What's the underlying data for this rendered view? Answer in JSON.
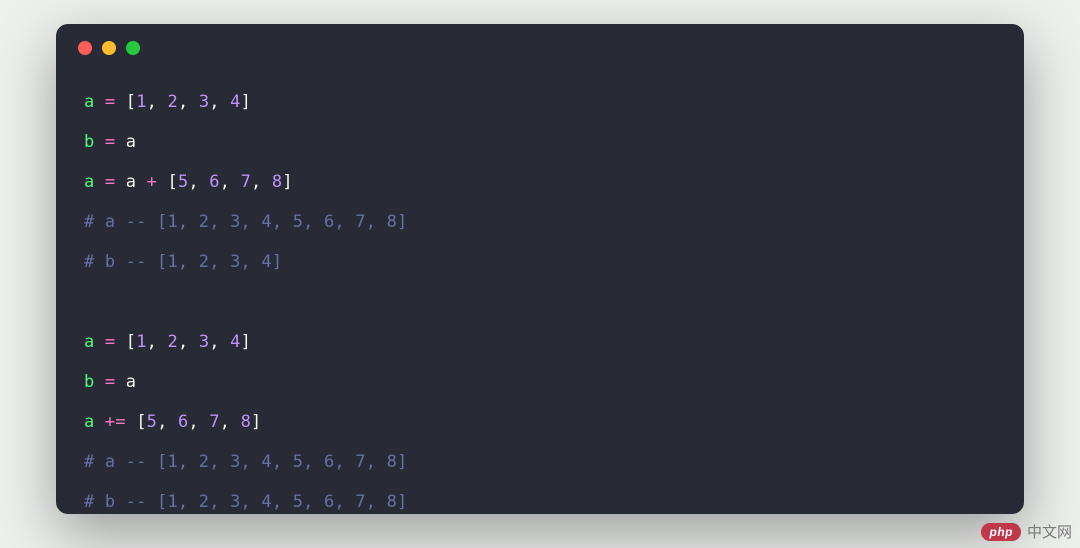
{
  "traffic_lights": [
    "red",
    "yellow",
    "green"
  ],
  "code": {
    "lines": [
      [
        {
          "cls": "tok-var",
          "t": "a"
        },
        {
          "cls": "tok-plain",
          "t": " "
        },
        {
          "cls": "tok-op",
          "t": "="
        },
        {
          "cls": "tok-plain",
          "t": " "
        },
        {
          "cls": "tok-bracket",
          "t": "["
        },
        {
          "cls": "tok-num",
          "t": "1"
        },
        {
          "cls": "tok-comma",
          "t": ", "
        },
        {
          "cls": "tok-num",
          "t": "2"
        },
        {
          "cls": "tok-comma",
          "t": ", "
        },
        {
          "cls": "tok-num",
          "t": "3"
        },
        {
          "cls": "tok-comma",
          "t": ", "
        },
        {
          "cls": "tok-num",
          "t": "4"
        },
        {
          "cls": "tok-bracket",
          "t": "]"
        }
      ],
      [
        {
          "cls": "tok-var",
          "t": "b"
        },
        {
          "cls": "tok-plain",
          "t": " "
        },
        {
          "cls": "tok-op",
          "t": "="
        },
        {
          "cls": "tok-plain",
          "t": " "
        },
        {
          "cls": "tok-plain",
          "t": "a"
        }
      ],
      [
        {
          "cls": "tok-var",
          "t": "a"
        },
        {
          "cls": "tok-plain",
          "t": " "
        },
        {
          "cls": "tok-op",
          "t": "="
        },
        {
          "cls": "tok-plain",
          "t": " a "
        },
        {
          "cls": "tok-op",
          "t": "+"
        },
        {
          "cls": "tok-plain",
          "t": " "
        },
        {
          "cls": "tok-bracket",
          "t": "["
        },
        {
          "cls": "tok-num",
          "t": "5"
        },
        {
          "cls": "tok-comma",
          "t": ", "
        },
        {
          "cls": "tok-num",
          "t": "6"
        },
        {
          "cls": "tok-comma",
          "t": ", "
        },
        {
          "cls": "tok-num",
          "t": "7"
        },
        {
          "cls": "tok-comma",
          "t": ", "
        },
        {
          "cls": "tok-num",
          "t": "8"
        },
        {
          "cls": "tok-bracket",
          "t": "]"
        }
      ],
      [
        {
          "cls": "tok-comment",
          "t": "# a -- [1, 2, 3, 4, 5, 6, 7, 8]"
        }
      ],
      [
        {
          "cls": "tok-comment",
          "t": "# b -- [1, 2, 3, 4]"
        }
      ],
      [],
      [
        {
          "cls": "tok-var",
          "t": "a"
        },
        {
          "cls": "tok-plain",
          "t": " "
        },
        {
          "cls": "tok-op",
          "t": "="
        },
        {
          "cls": "tok-plain",
          "t": " "
        },
        {
          "cls": "tok-bracket",
          "t": "["
        },
        {
          "cls": "tok-num",
          "t": "1"
        },
        {
          "cls": "tok-comma",
          "t": ", "
        },
        {
          "cls": "tok-num",
          "t": "2"
        },
        {
          "cls": "tok-comma",
          "t": ", "
        },
        {
          "cls": "tok-num",
          "t": "3"
        },
        {
          "cls": "tok-comma",
          "t": ", "
        },
        {
          "cls": "tok-num",
          "t": "4"
        },
        {
          "cls": "tok-bracket",
          "t": "]"
        }
      ],
      [
        {
          "cls": "tok-var",
          "t": "b"
        },
        {
          "cls": "tok-plain",
          "t": " "
        },
        {
          "cls": "tok-op",
          "t": "="
        },
        {
          "cls": "tok-plain",
          "t": " "
        },
        {
          "cls": "tok-plain",
          "t": "a"
        }
      ],
      [
        {
          "cls": "tok-var",
          "t": "a"
        },
        {
          "cls": "tok-plain",
          "t": " "
        },
        {
          "cls": "tok-op",
          "t": "+="
        },
        {
          "cls": "tok-plain",
          "t": " "
        },
        {
          "cls": "tok-bracket",
          "t": "["
        },
        {
          "cls": "tok-num",
          "t": "5"
        },
        {
          "cls": "tok-comma",
          "t": ", "
        },
        {
          "cls": "tok-num",
          "t": "6"
        },
        {
          "cls": "tok-comma",
          "t": ", "
        },
        {
          "cls": "tok-num",
          "t": "7"
        },
        {
          "cls": "tok-comma",
          "t": ", "
        },
        {
          "cls": "tok-num",
          "t": "8"
        },
        {
          "cls": "tok-bracket",
          "t": "]"
        }
      ],
      [
        {
          "cls": "tok-comment",
          "t": "# a -- [1, 2, 3, 4, 5, 6, 7, 8]"
        }
      ],
      [
        {
          "cls": "tok-comment",
          "t": "# b -- [1, 2, 3, 4, 5, 6, 7, 8]"
        }
      ]
    ]
  },
  "watermark": {
    "badge": "php",
    "text": "中文网"
  }
}
